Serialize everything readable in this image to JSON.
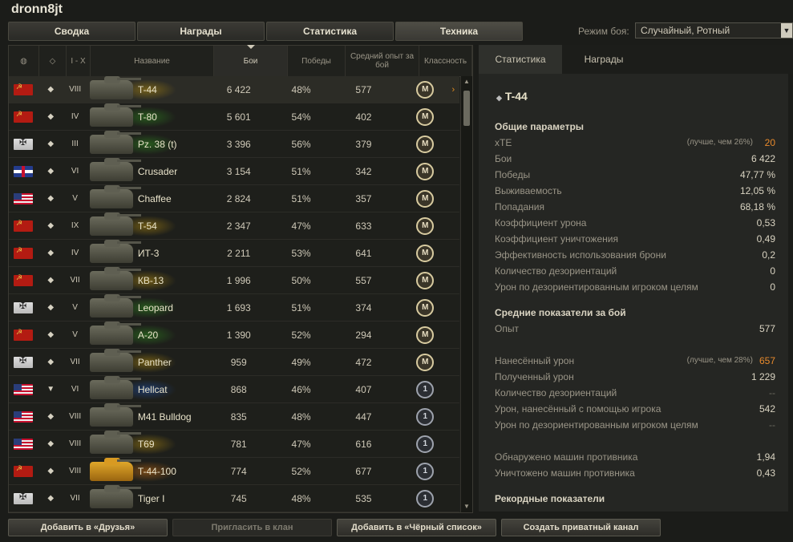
{
  "player_name": "dronn8jt",
  "tabs": [
    "Сводка",
    "Награды",
    "Статистика",
    "Техника"
  ],
  "battle_mode": {
    "label": "Режим боя:",
    "selected": "Случайный, Ротный"
  },
  "table": {
    "headers": {
      "tier": "I - X",
      "name": "Название",
      "battles": "Бои",
      "wins": "Победы",
      "avg_exp": "Средний опыт за бой",
      "mastery": "Классность"
    },
    "rows": [
      {
        "nation": "ussr",
        "tier": "VIII",
        "name": "T-44",
        "battles": "6 422",
        "wins": "48%",
        "exp": "577",
        "mastery": "M",
        "glow": "yellow",
        "type": "◆"
      },
      {
        "nation": "ussr",
        "tier": "IV",
        "name": "T-80",
        "battles": "5 601",
        "wins": "54%",
        "exp": "402",
        "mastery": "M",
        "glow": "green",
        "type": "◆"
      },
      {
        "nation": "germany",
        "tier": "III",
        "name": "Pz. 38 (t)",
        "battles": "3 396",
        "wins": "56%",
        "exp": "379",
        "mastery": "M",
        "glow": "green",
        "type": "◆"
      },
      {
        "nation": "uk",
        "tier": "VI",
        "name": "Crusader",
        "battles": "3 154",
        "wins": "51%",
        "exp": "342",
        "mastery": "M",
        "glow": "none",
        "type": "◆"
      },
      {
        "nation": "usa",
        "tier": "V",
        "name": "Chaffee",
        "battles": "2 824",
        "wins": "51%",
        "exp": "357",
        "mastery": "M",
        "glow": "none",
        "type": "◆"
      },
      {
        "nation": "ussr",
        "tier": "IX",
        "name": "T-54",
        "battles": "2 347",
        "wins": "47%",
        "exp": "633",
        "mastery": "M",
        "glow": "yellow",
        "type": "◆"
      },
      {
        "nation": "ussr",
        "tier": "IV",
        "name": "ИТ-3",
        "battles": "2 211",
        "wins": "53%",
        "exp": "641",
        "mastery": "M",
        "glow": "none",
        "type": "◆"
      },
      {
        "nation": "ussr",
        "tier": "VII",
        "name": "КВ-13",
        "battles": "1 996",
        "wins": "50%",
        "exp": "557",
        "mastery": "M",
        "glow": "yellow",
        "type": "◆"
      },
      {
        "nation": "germany",
        "tier": "V",
        "name": "Leopard",
        "battles": "1 693",
        "wins": "51%",
        "exp": "374",
        "mastery": "M",
        "glow": "green",
        "type": "◆"
      },
      {
        "nation": "ussr",
        "tier": "V",
        "name": "A-20",
        "battles": "1 390",
        "wins": "52%",
        "exp": "294",
        "mastery": "M",
        "glow": "green",
        "type": "◆"
      },
      {
        "nation": "germany",
        "tier": "VII",
        "name": "Panther",
        "battles": "959",
        "wins": "49%",
        "exp": "472",
        "mastery": "M",
        "glow": "yellow",
        "type": "◆"
      },
      {
        "nation": "usa",
        "tier": "VI",
        "name": "Hellcat",
        "battles": "868",
        "wins": "46%",
        "exp": "407",
        "mastery": "1",
        "glow": "blue",
        "type": "▼"
      },
      {
        "nation": "usa",
        "tier": "VIII",
        "name": "M41 Bulldog",
        "battles": "835",
        "wins": "48%",
        "exp": "447",
        "mastery": "1",
        "glow": "none",
        "type": "◆"
      },
      {
        "nation": "usa",
        "tier": "VIII",
        "name": "T69",
        "battles": "781",
        "wins": "47%",
        "exp": "616",
        "mastery": "1",
        "glow": "yellow",
        "type": "◆"
      },
      {
        "nation": "ussr",
        "tier": "VIII",
        "name": "T-44-100",
        "battles": "774",
        "wins": "52%",
        "exp": "677",
        "mastery": "1",
        "glow": "orange",
        "type": "◆",
        "gold": true
      },
      {
        "nation": "germany",
        "tier": "VII",
        "name": "Tiger I",
        "battles": "745",
        "wins": "48%",
        "exp": "535",
        "mastery": "1",
        "glow": "none",
        "type": "◆"
      }
    ]
  },
  "panel": {
    "tabs": [
      "Статистика",
      "Награды"
    ],
    "vehicle": "T-44",
    "sections": [
      {
        "title": "Общие параметры",
        "stats": [
          {
            "label": "xTE",
            "hint": "(лучше, чем 26%)",
            "value": "20",
            "style": "orange"
          },
          {
            "label": "Бои",
            "value": "6 422"
          },
          {
            "label": "Победы",
            "value": "47,77 %"
          },
          {
            "label": "Выживаемость",
            "value": "12,05 %"
          },
          {
            "label": "Попадания",
            "value": "68,18 %"
          },
          {
            "label": "Коэффициент урона",
            "value": "0,53"
          },
          {
            "label": "Коэффициент уничтожения",
            "value": "0,49"
          },
          {
            "label": "Эффективность использования брони",
            "value": "0,2"
          },
          {
            "label": "Количество дезориентаций",
            "value": "0"
          },
          {
            "label": "Урон по дезориентированным игроком целям",
            "value": "0"
          }
        ]
      },
      {
        "title": "Средние показатели за бой",
        "stats": [
          {
            "label": "Опыт",
            "value": "577"
          },
          {
            "gap": true
          },
          {
            "label": "Нанесённый урон",
            "hint": "(лучше, чем 28%)",
            "value": "657",
            "style": "orange"
          },
          {
            "label": "Полученный урон",
            "value": "1 229"
          },
          {
            "label": "Количество дезориентаций",
            "value": "--",
            "style": "dim"
          },
          {
            "label": "Урон, нанесённый с помощью игрока",
            "value": "542"
          },
          {
            "label": "Урон по дезориентированным игроком целям",
            "value": "--",
            "style": "dim"
          },
          {
            "gap": true
          },
          {
            "label": "Обнаружено машин противника",
            "value": "1,94"
          },
          {
            "label": "Уничтожено машин противника",
            "value": "0,43"
          }
        ]
      },
      {
        "title": "Рекордные показатели",
        "stats": []
      }
    ]
  },
  "buttons": [
    {
      "label": "Добавить в «Друзья»",
      "disabled": false
    },
    {
      "label": "Пригласить в клан",
      "disabled": true
    },
    {
      "label": "Добавить в «Чёрный список»",
      "disabled": false
    },
    {
      "label": "Создать приватный канал",
      "disabled": false
    }
  ]
}
